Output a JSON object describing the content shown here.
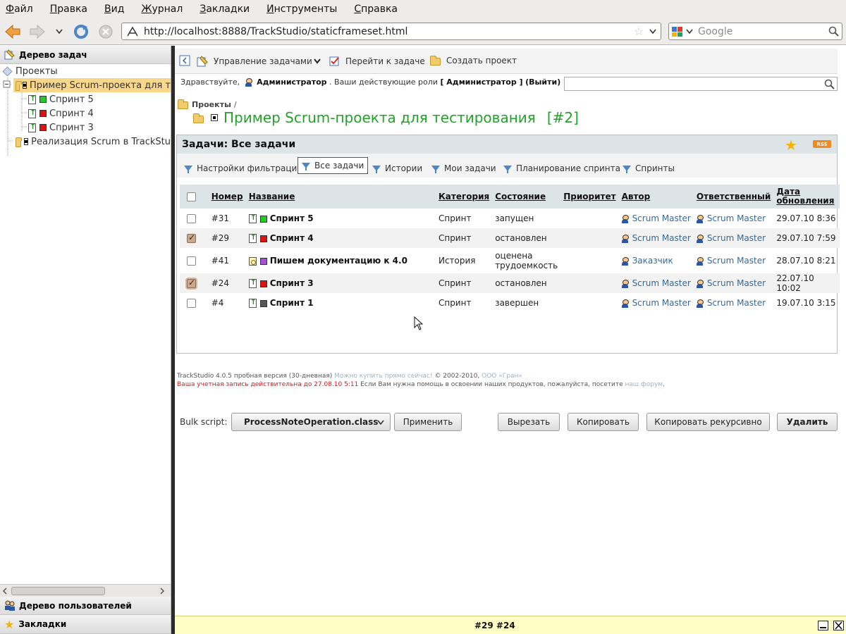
{
  "browser": {
    "menu": [
      "Файл",
      "Правка",
      "Вид",
      "Журнал",
      "Закладки",
      "Инструменты",
      "Справка"
    ],
    "url": "http://localhost:8888/TrackStudio/staticframeset.html",
    "search_placeholder": "Google"
  },
  "left": {
    "tasks_tree_title": "Дерево задач",
    "tree": [
      {
        "label": "Проекты",
        "level": 0,
        "icon": "projects-cube-icon"
      },
      {
        "label": "Пример Scrum-проекта для т",
        "level": 1,
        "icon": "folder-icon",
        "selected": true
      },
      {
        "label": "Спринт 5",
        "level": 2,
        "icon": "sprint-icon",
        "color": "#22cc22"
      },
      {
        "label": "Спринт 4",
        "level": 2,
        "icon": "sprint-icon",
        "color": "#dd1111"
      },
      {
        "label": "Спринт 3",
        "level": 2,
        "icon": "sprint-icon",
        "color": "#dd1111"
      },
      {
        "label": "Реализация Scrum в TrackStu",
        "level": 1,
        "icon": "folder-icon"
      }
    ],
    "users_tree_title": "Дерево пользователей",
    "bookmarks_title": "Закладки"
  },
  "toolbar": {
    "manage": "Управление задачами",
    "goto": "Перейти к задаче",
    "create": "Создать проект"
  },
  "greeting": {
    "hello": "Здравствуйте,",
    "user": "Администратор",
    "roles_text": ". Ваши действующие роли",
    "role": "[ Администратор ]",
    "logout": "(Выйти)"
  },
  "breadcrumb": {
    "root": "Проекты",
    "sep": "/"
  },
  "project_title": "Пример Scrum-проекта для тестирования",
  "project_id": "[#2]",
  "tasks_panel": {
    "title": "Задачи: Все задачи",
    "rss": "RSS",
    "filters": [
      "Настройки фильтрации",
      "Все задачи",
      "Истории",
      "Мои задачи",
      "Планирование спринта",
      "Спринты"
    ],
    "active_filter": "Все задачи",
    "columns": [
      "Номер",
      "Название",
      "Категория",
      "Состояние",
      "Приоритет",
      "Автор",
      "Ответственный",
      "Дата обновления"
    ],
    "rows": [
      {
        "num": "#31",
        "name": "Спринт 5",
        "color": "#22cc22",
        "icon": "sprint-icon",
        "category": "Спринт",
        "state": "запущен",
        "priority": "",
        "author": "Scrum Master",
        "responsible": "Scrum Master",
        "updated": "29.07.10 8:36",
        "checked": false
      },
      {
        "num": "#29",
        "name": "Спринт 4",
        "color": "#dd1111",
        "icon": "sprint-icon",
        "category": "Спринт",
        "state": "остановлен",
        "priority": "",
        "author": "Scrum Master",
        "responsible": "Scrum Master",
        "updated": "29.07.10 7:59",
        "checked": true
      },
      {
        "num": "#41",
        "name": "Пишем документацию к 4.0",
        "color": "#a64ddc",
        "icon": "history-icon",
        "category": "История",
        "state": "оценена трудоемкость",
        "priority": "",
        "author": "Заказчик",
        "responsible": "Scrum Master",
        "updated": "28.07.10 8:21",
        "checked": false
      },
      {
        "num": "#24",
        "name": "Спринт 3",
        "color": "#dd1111",
        "icon": "sprint-icon",
        "category": "Спринт",
        "state": "остановлен",
        "priority": "",
        "author": "Scrum Master",
        "responsible": "Scrum Master",
        "updated": "22.07.10 10:02",
        "checked": true
      },
      {
        "num": "#4",
        "name": "Спринт 1",
        "color": "#555555",
        "icon": "sprint-icon",
        "category": "Спринт",
        "state": "завершен",
        "priority": "",
        "author": "Scrum Master",
        "responsible": "Scrum Master",
        "updated": "19.07.10 3:15",
        "checked": false
      }
    ],
    "bulk_label": "Bulk script:",
    "bulk_value": "ProcessNoteOperation.class",
    "apply": "Применить",
    "cut": "Вырезать",
    "copy": "Копировать",
    "copy_recursive": "Копировать рекурсивно",
    "delete": "Удалить"
  },
  "footer": {
    "version": "TrackStudio 4.0.5 пробная версия (30-дневная)",
    "buy": "Можно купить прямо сейчас!",
    "copyright": "© 2002-2010,",
    "company": "ООО «Гран»",
    "account": "Ваша учетная запись действительна до 27.08.10 5:11",
    "help": "Если Вам нужна помощь в освоении наших продуктов, пожалуйста, посетите",
    "forum": "наш форум",
    "dot": "."
  },
  "status": {
    "selected": "#29 #24"
  }
}
